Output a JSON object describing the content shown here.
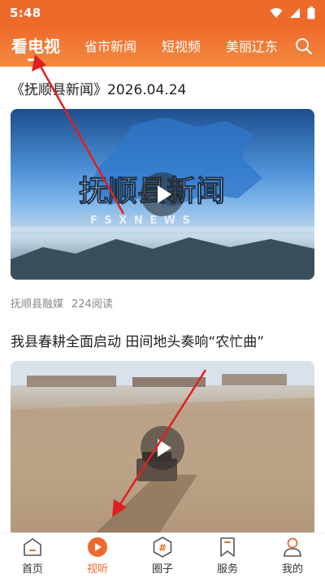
{
  "status": {
    "time": "5:48"
  },
  "tabs": [
    {
      "label": "看电视",
      "active": true
    },
    {
      "label": "省市新闻"
    },
    {
      "label": "短视频"
    },
    {
      "label": "美丽辽东"
    }
  ],
  "feed": {
    "items": [
      {
        "title": "《抚顺县新闻》2026.04.24",
        "video_title": "抚顺县新闻",
        "video_subtitle": "F S X N E W S",
        "source": "抚顺县融媒",
        "reads": "224阅读"
      },
      {
        "title": "我县春耕全面启动 田间地头奏响“农忙曲”"
      }
    ]
  },
  "bottom_nav": [
    {
      "label": "首页",
      "icon": "home-icon"
    },
    {
      "label": "视听",
      "icon": "play-circle-icon",
      "active": true
    },
    {
      "label": "圈子",
      "icon": "hashtag-icon"
    },
    {
      "label": "服务",
      "icon": "bookmark-icon"
    },
    {
      "label": "我的",
      "icon": "user-icon"
    }
  ],
  "colors": {
    "accent": "#ee6a2a",
    "annotation": "#e02020"
  }
}
